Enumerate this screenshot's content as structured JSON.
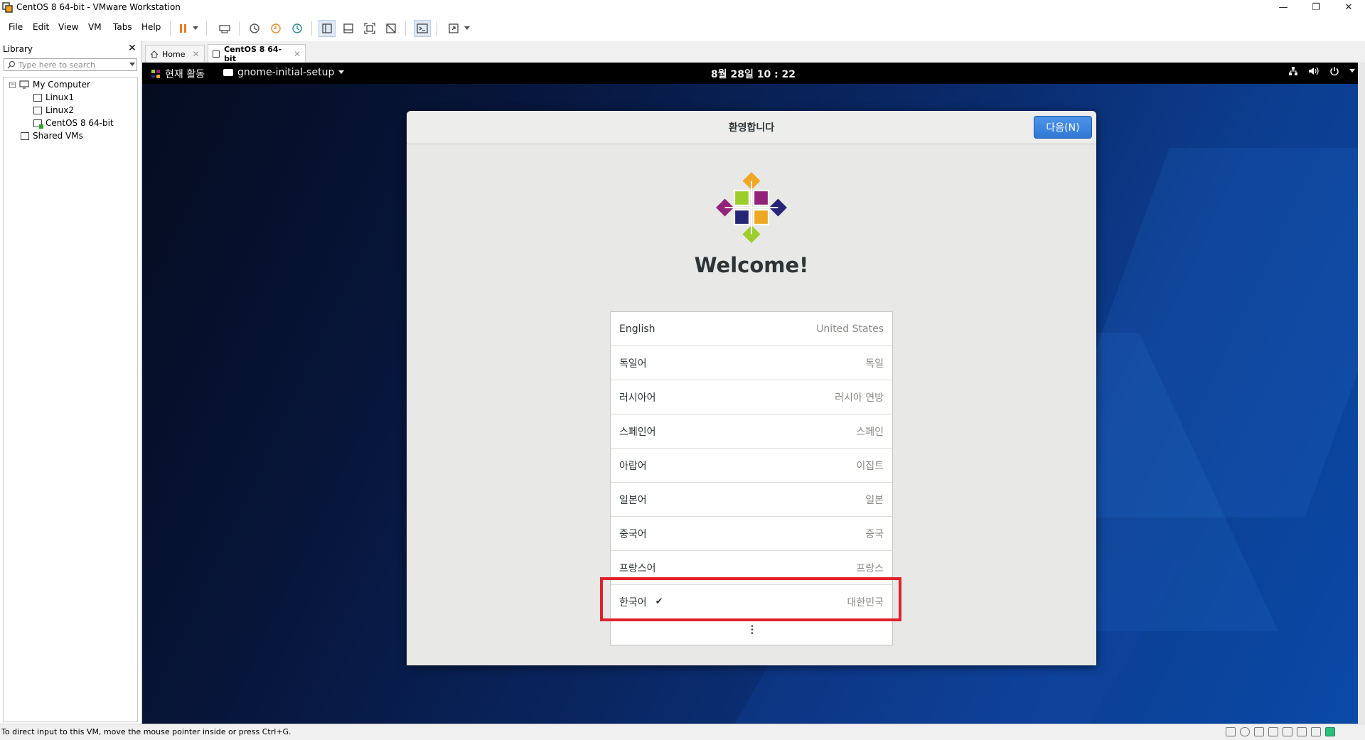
{
  "window": {
    "title": "CentOS 8 64-bit - VMware Workstation",
    "minimize_glyph": "—",
    "restore_glyph": "❐",
    "close_glyph": "✕"
  },
  "menu": {
    "file": "File",
    "edit": "Edit",
    "view": "View",
    "vm": "VM",
    "tabs": "Tabs",
    "help": "Help"
  },
  "library": {
    "header": "Library",
    "close_glyph": "✕",
    "search_placeholder": "Type here to search",
    "tree": {
      "my_computer": "My Computer",
      "vms": [
        "Linux1",
        "Linux2",
        "CentOS 8 64-bit"
      ],
      "shared": "Shared VMs"
    }
  },
  "tabs": {
    "home": "Home",
    "vm": "CentOS 8 64-bit",
    "close_glyph": "✕"
  },
  "gnome": {
    "activities": "현재 활동",
    "app_menu": "gnome-initial-setup",
    "clock": "8월 28일  10 : 22"
  },
  "dialog": {
    "title": "환영합니다",
    "next_button": "다음(N)",
    "welcome": "Welcome!",
    "languages": [
      {
        "name": "English",
        "region": "United States",
        "selected": false
      },
      {
        "name": "독일어",
        "region": "독일",
        "selected": false
      },
      {
        "name": "러시아어",
        "region": "러시아 연방",
        "selected": false
      },
      {
        "name": "스페인어",
        "region": "스페인",
        "selected": false
      },
      {
        "name": "아랍어",
        "region": "이집트",
        "selected": false
      },
      {
        "name": "일본어",
        "region": "일본",
        "selected": false
      },
      {
        "name": "중국어",
        "region": "중국",
        "selected": false
      },
      {
        "name": "프랑스어",
        "region": "프랑스",
        "selected": false
      },
      {
        "name": "한국어",
        "region": "대한민국",
        "selected": true
      }
    ],
    "check_glyph": "✔"
  },
  "statusbar": {
    "message": "To direct input to this VM, move the mouse pointer inside or press Ctrl+G."
  },
  "colors": {
    "highlight_box": "#e0212c",
    "next_button": "#3178d5"
  }
}
